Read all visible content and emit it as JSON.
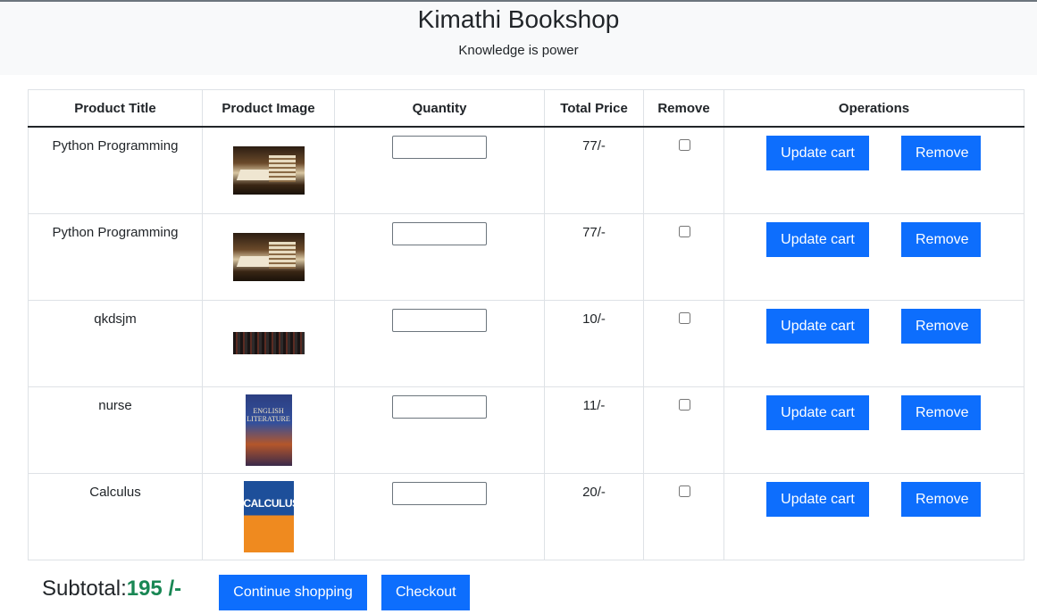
{
  "header": {
    "title": "Kimathi Bookshop",
    "tagline": "Knowledge is power"
  },
  "table": {
    "columns": [
      "Product Title",
      "Product Image",
      "Quantity",
      "Total Price",
      "Remove",
      "Operations"
    ],
    "rows": [
      {
        "title": "Python Programming",
        "image": "books-photo",
        "quantity": "",
        "price": "77/-",
        "remove_checked": false,
        "update_label": "Update cart",
        "remove_label": "Remove"
      },
      {
        "title": "Python Programming",
        "image": "books-photo",
        "quantity": "",
        "price": "77/-",
        "remove_checked": false,
        "update_label": "Update cart",
        "remove_label": "Remove"
      },
      {
        "title": "qkdsjm",
        "image": "bookshelf-photo",
        "quantity": "",
        "price": "10/-",
        "remove_checked": false,
        "update_label": "Update cart",
        "remove_label": "Remove"
      },
      {
        "title": "nurse",
        "image": "english-literature-cover",
        "quantity": "",
        "price": "11/-",
        "remove_checked": false,
        "update_label": "Update cart",
        "remove_label": "Remove"
      },
      {
        "title": "Calculus",
        "image": "calculus-cover",
        "quantity": "",
        "price": "20/-",
        "remove_checked": false,
        "update_label": "Update cart",
        "remove_label": "Remove"
      }
    ]
  },
  "footer": {
    "subtotal_label": "Subtotal:",
    "subtotal_value": "195 /-",
    "continue_label": "Continue shopping",
    "checkout_label": "Checkout"
  },
  "covers": {
    "lit_text": "ENGLISH LITERATURE",
    "calc_text": "CALCULUS"
  },
  "colors": {
    "primary": "#0d6efd",
    "success": "#198754",
    "header_bg": "#f8f9fa"
  }
}
